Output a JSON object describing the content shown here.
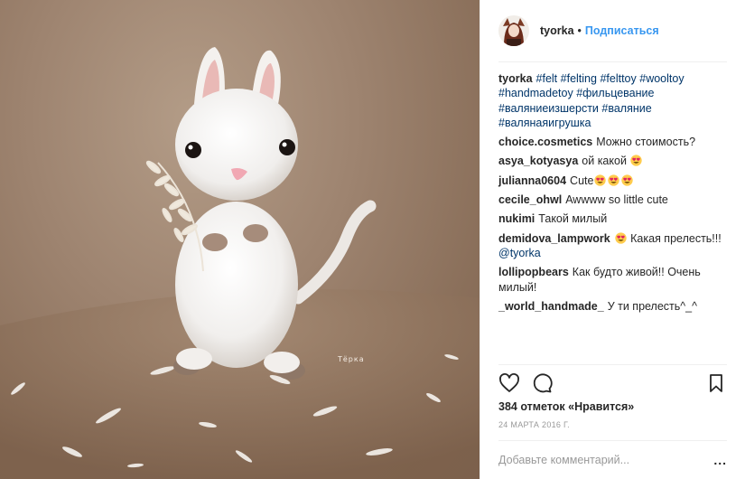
{
  "photo": {
    "watermark": "Тёрка",
    "alt": ""
  },
  "header": {
    "username": "tyorka",
    "separator": "•",
    "follow_label": "Подписаться"
  },
  "caption": {
    "username": "tyorka",
    "hashtags_line1": [
      "#felt",
      "#felting",
      "#felttoy",
      "#wooltoy"
    ],
    "hashtags_line2": [
      "#handmadetoy",
      "#фильцевание"
    ],
    "hashtags_line3": [
      "#валяниеизшерсти",
      "#валяние"
    ],
    "hashtags_line4": [
      "#валянаяигрушка"
    ]
  },
  "comments": [
    {
      "user": "choice.cosmetics",
      "text": "Можно стоимость?"
    },
    {
      "user": "asya_kotyasya",
      "text": "ой какой",
      "emoji_after": 1
    },
    {
      "user": "julianna0604",
      "text": "Cute",
      "emoji_after": 3
    },
    {
      "user": "cecile_ohwl",
      "text": "Awwww so little cute"
    },
    {
      "user": "nukimi",
      "text": "Такой милый"
    },
    {
      "user": "demidova_lampwork",
      "emoji_before": 1,
      "text": "Какая прелесть!!!",
      "mention": "@tyorka"
    },
    {
      "user": "lollipopbears",
      "text": "Как будто живой!! Очень милый!"
    },
    {
      "user": "_world_handmade_",
      "text": "У ти прелесть^_^"
    }
  ],
  "icons": {
    "like": "heart-outline-icon",
    "comment": "speech-bubble-icon",
    "save": "bookmark-icon",
    "emoji": "heart-eyes-emoji"
  },
  "likes_text": "384 отметок «Нравится»",
  "date_text": "24 МАРТА 2016 Г.",
  "add_comment": {
    "placeholder": "Добавьте комментарий...",
    "more_label": "..."
  },
  "colors": {
    "link": "#3897f0",
    "hashtag": "#003569",
    "border": "#efefef",
    "muted": "#999999"
  }
}
